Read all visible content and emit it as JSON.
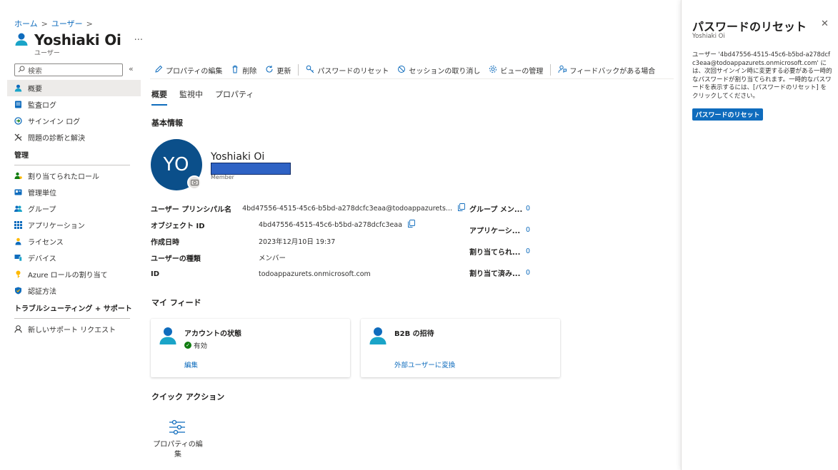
{
  "breadcrumb": {
    "home": "ホーム",
    "users": "ユーザー",
    "sep": ">"
  },
  "header": {
    "title": "Yoshiaki Oi",
    "subtitle": "ユーザー",
    "more": "···"
  },
  "search": {
    "placeholder": "検索",
    "collapse": "«"
  },
  "sidebar": {
    "items": [
      {
        "label": "概要"
      },
      {
        "label": "監査ログ"
      },
      {
        "label": "サインイン ログ"
      },
      {
        "label": "問題の診断と解決"
      }
    ],
    "section_manage": "管理",
    "manage_items": [
      {
        "label": "割り当てられたロール"
      },
      {
        "label": "管理単位"
      },
      {
        "label": "グループ"
      },
      {
        "label": "アプリケーション"
      },
      {
        "label": "ライセンス"
      },
      {
        "label": "デバイス"
      },
      {
        "label": "Azure ロールの割り当て"
      },
      {
        "label": "認証方法"
      }
    ],
    "section_troubleshoot": "トラブルシューティング + サポート",
    "support_items": [
      {
        "label": "新しいサポート リクエスト"
      }
    ]
  },
  "toolbar": {
    "edit": "プロパティの編集",
    "delete": "削除",
    "refresh": "更新",
    "reset_password": "パスワードのリセット",
    "revoke_sessions": "セッションの取り消し",
    "manage_view": "ビューの管理",
    "feedback": "フィードバックがある場合"
  },
  "tabs": [
    "概要",
    "監視中",
    "プロパティ"
  ],
  "basic_info": {
    "title": "基本情報",
    "initials": "YO",
    "name": "Yoshiaki Oi",
    "role": "Member"
  },
  "properties": [
    {
      "label": "ユーザー プリンシパル名",
      "value": "4bd47556-4515-45c6-b5bd-a278dcfc3eaa@todoappazurets...",
      "copy": true
    },
    {
      "label": "オブジェクト ID",
      "value": "4bd47556-4515-45c6-b5bd-a278dcfc3eaa",
      "copy": true
    },
    {
      "label": "作成日時",
      "value": "2023年12月10日 19:37"
    },
    {
      "label": "ユーザーの種類",
      "value": "メンバー"
    },
    {
      "label": "ID",
      "value": "todoappazurets.onmicrosoft.com",
      "link": true
    }
  ],
  "counts": [
    {
      "label": "グループ メン...",
      "value": "0"
    },
    {
      "label": "アプリケーシ...",
      "value": "0"
    },
    {
      "label": "割り当てられ...",
      "value": "0"
    },
    {
      "label": "割り当て済み...",
      "value": "0"
    }
  ],
  "my_feed": {
    "title": "マイ フィード",
    "cards": [
      {
        "title": "アカウントの状態",
        "status": "有効",
        "link": "編集"
      },
      {
        "title": "B2B の招待",
        "link": "外部ユーザーに変換"
      }
    ]
  },
  "quick_actions": {
    "title": "クイック アクション",
    "items": [
      {
        "label": "プロパティの編集"
      }
    ]
  },
  "panel": {
    "title": "パスワードのリセット",
    "subtitle": "Yoshiaki Oi",
    "description": "ユーザー '4bd47556-4515-45c6-b5bd-a278dcfc3eaa@todoappazurets.onmicrosoft.com' には、次回サインイン時に変更する必要がある一時的なパスワードが割り当てられます。一時的なパスワードを表示するには、[パスワードのリセット] をクリックしてください。",
    "button": "パスワードのリセット",
    "close": "✕"
  },
  "colors": {
    "accent": "#0f6cbd",
    "avatar_bg": "#0b4f8a",
    "ok": "#107c10"
  }
}
